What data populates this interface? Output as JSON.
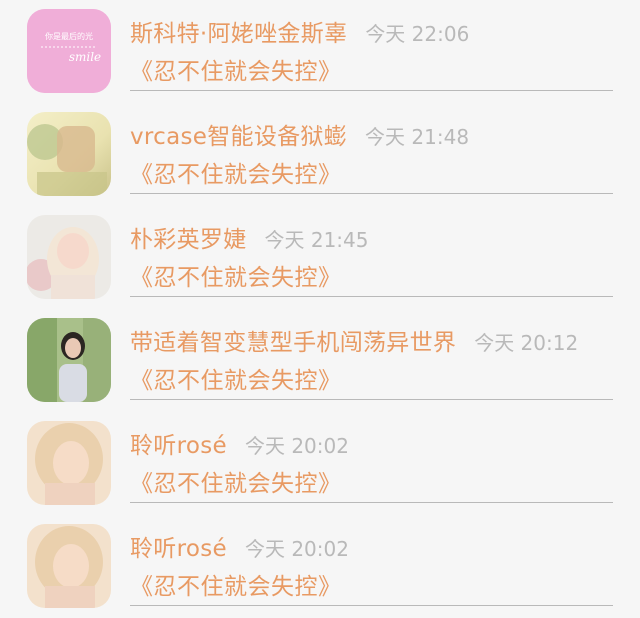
{
  "items": [
    {
      "name": "斯科特·阿姥唑金斯辜",
      "time": "今天 22:06",
      "title": "《忍不住就会失控》",
      "avatar_text": "smile",
      "avatar_sub": "你是最后的光"
    },
    {
      "name": "vrcase智能设备狱蟛",
      "time": "今天 21:48",
      "title": "《忍不住就会失控》"
    },
    {
      "name": "朴彩英罗婕",
      "time": "今天 21:45",
      "title": "《忍不住就会失控》"
    },
    {
      "name": "带适着智变慧型手机闯荡异世界",
      "time": "今天 20:12",
      "title": "《忍不住就会失控》"
    },
    {
      "name": "聆听rosé",
      "time": "今天 20:02",
      "title": "《忍不住就会失控》"
    },
    {
      "name": "聆听rosé",
      "time": "今天 20:02",
      "title": "《忍不住就会失控》"
    }
  ],
  "colors": {
    "accent": "#e89a63",
    "muted": "#b9b9b9",
    "background": "#f6f6f6"
  }
}
